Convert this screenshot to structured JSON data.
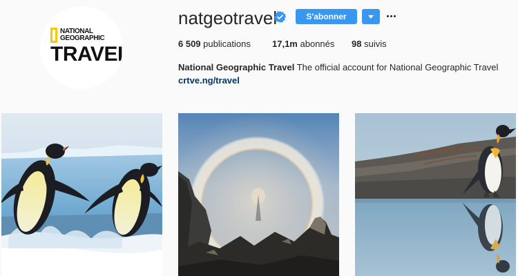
{
  "profile": {
    "logo": {
      "line1": "NATIONAL",
      "line2": "GEOGRAPHIC",
      "line3": "TRAVEL"
    },
    "username": "natgeotravel",
    "verified": true,
    "follow_label": "S'abonner",
    "stats": {
      "posts_count": "6 509",
      "posts_label": "publications",
      "followers_count": "17,1m",
      "followers_label": "abonnés",
      "following_count": "98",
      "following_label": "suivis"
    },
    "bio": {
      "full_name": "National Geographic Travel",
      "description": "The official account for National Geographic Travel",
      "link": "crtve.ng/travel"
    }
  },
  "colors": {
    "accent": "#3897f0",
    "link": "#003569",
    "logo_yellow": "#f7c800",
    "background": "#fafafa"
  },
  "posts": [
    {
      "subject": "emperor penguins jumping onto ice"
    },
    {
      "subject": "glory halo over foggy mountain silhouette"
    },
    {
      "subject": "king penguin reflected in water"
    }
  ]
}
